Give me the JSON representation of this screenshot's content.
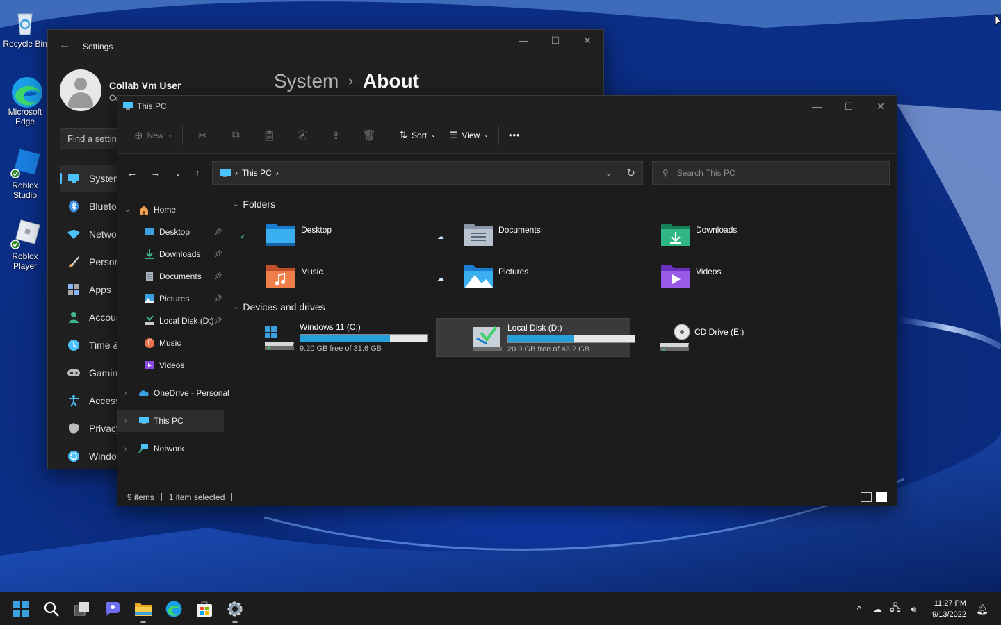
{
  "desktop": {
    "icons": [
      {
        "label": "Recycle Bin"
      },
      {
        "label": "Microsoft Edge"
      },
      {
        "label": "Roblox Studio"
      },
      {
        "label": "Roblox Player"
      }
    ]
  },
  "settings": {
    "title": "Settings",
    "user_name": "Collab Vm User",
    "user_sub": "Co...",
    "breadcrumb_parent": "System",
    "breadcrumb_sep": "›",
    "breadcrumb_current": "About",
    "find_placeholder": "Find a settin",
    "nav": [
      {
        "label": "System",
        "icon": "monitor-icon",
        "color": "#4cc2ff"
      },
      {
        "label": "Bluetooth",
        "icon": "bluetooth-icon",
        "color": "#3a8ee6"
      },
      {
        "label": "Network",
        "icon": "wifi-icon",
        "color": "#4cc2ff"
      },
      {
        "label": "Personalization",
        "icon": "brush-icon",
        "color": "#f0a050"
      },
      {
        "label": "Apps",
        "icon": "apps-icon",
        "color": "#8ab4f8"
      },
      {
        "label": "Accounts",
        "icon": "person-icon",
        "color": "#3fb68b"
      },
      {
        "label": "Time & language",
        "icon": "clock-icon",
        "color": "#4cc2ff"
      },
      {
        "label": "Gaming",
        "icon": "gamepad-icon",
        "color": "#bbbbbb"
      },
      {
        "label": "Accessibility",
        "icon": "accessibility-icon",
        "color": "#4cc2ff"
      },
      {
        "label": "Privacy & security",
        "icon": "shield-icon",
        "color": "#bbbbbb"
      },
      {
        "label": "Windows Update",
        "icon": "update-icon",
        "color": "#4cc2ff"
      }
    ]
  },
  "explorer": {
    "title": "This PC",
    "toolbar": {
      "new_label": "New",
      "sort_label": "Sort",
      "view_label": "View",
      "more_label": "•••"
    },
    "address": {
      "location": "This PC"
    },
    "search_placeholder": "Search This PC",
    "sidebar": {
      "home": "Home",
      "quick": [
        {
          "label": "Desktop",
          "pinned": true
        },
        {
          "label": "Downloads",
          "pinned": true
        },
        {
          "label": "Documents",
          "pinned": true
        },
        {
          "label": "Pictures",
          "pinned": true
        },
        {
          "label": "Local Disk (D:)",
          "pinned": true
        },
        {
          "label": "Music",
          "pinned": false
        },
        {
          "label": "Videos",
          "pinned": false
        }
      ],
      "onedrive": "OneDrive - Personal",
      "thispc": "This PC",
      "network": "Network"
    },
    "folders_heading": "Folders",
    "folders": [
      {
        "name": "Desktop",
        "status": "synced"
      },
      {
        "name": "Documents",
        "status": "cloud"
      },
      {
        "name": "Downloads",
        "status": ""
      },
      {
        "name": "Music",
        "status": ""
      },
      {
        "name": "Pictures",
        "status": "cloud"
      },
      {
        "name": "Videos",
        "status": ""
      }
    ],
    "drives_heading": "Devices and drives",
    "drives": [
      {
        "name": "Windows 11 (C:)",
        "free": "9.20 GB free of 31.6 GB",
        "used_fraction": 0.71
      },
      {
        "name": "Local Disk (D:)",
        "free": "20.9 GB free of 43.2 GB",
        "used_fraction": 0.52
      },
      {
        "name": "CD Drive (E:)"
      }
    ],
    "status": {
      "items": "9 items",
      "selected": "1 item selected"
    }
  },
  "taskbar": {
    "time": "11:27 PM",
    "date": "9/13/2022"
  }
}
